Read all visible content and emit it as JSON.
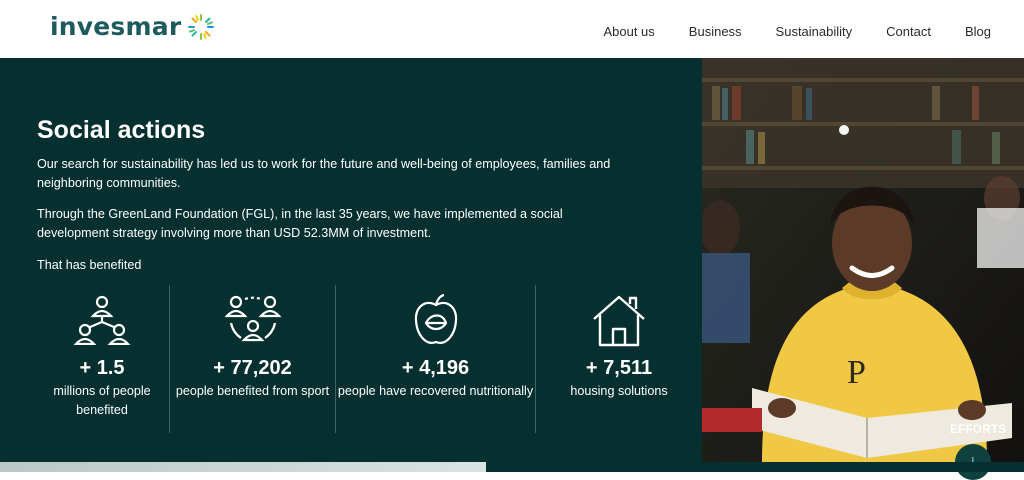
{
  "brand": {
    "name": "invesmar",
    "accent": "#1d5b5c",
    "hero_bg": "#05302f"
  },
  "nav": [
    "About us",
    "Business",
    "Sustainability",
    "Contact",
    "Blog"
  ],
  "hero": {
    "title": "Social actions",
    "paragraph1": "Our search for sustainability has led us to work for the future and well-being of employees, families and neighboring communities.",
    "paragraph2": "Through the GreenLand Foundation (FGL), in the last 35 years, we have implemented a social development strategy involving more than USD 52.3MM of investment.",
    "paragraph3": "That has benefited"
  },
  "stats": [
    {
      "icon": "people-network-icon",
      "value": "+ 1.5",
      "label": "millions of people benefited"
    },
    {
      "icon": "group-icon",
      "value": "+ 77,202",
      "label": "people benefited from sport"
    },
    {
      "icon": "apple-icon",
      "value": "+ 4,196",
      "label": "people have recovered nutritionally"
    },
    {
      "icon": "house-icon",
      "value": "+ 7,511",
      "label": "housing solutions"
    }
  ],
  "efforts": {
    "label": "EFFORTS",
    "icon": "arrow-down-icon"
  },
  "photo": {
    "description_icon": "photo-girl-reading"
  }
}
